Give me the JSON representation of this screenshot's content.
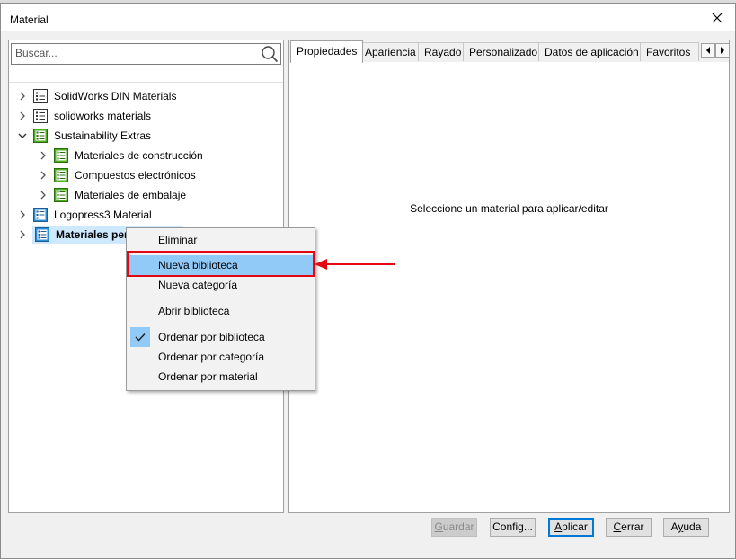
{
  "window": {
    "title": "Material"
  },
  "search": {
    "placeholder": "Buscar..."
  },
  "tree": {
    "items": [
      {
        "label": "SolidWorks DIN Materials"
      },
      {
        "label": "solidworks materials"
      },
      {
        "label": "Sustainability Extras"
      },
      {
        "label": "Materiales de construcción"
      },
      {
        "label": "Compuestos electrónicos"
      },
      {
        "label": "Materiales de embalaje"
      },
      {
        "label": "Logopress3 Material"
      },
      {
        "label": "Materiales pers"
      }
    ]
  },
  "tabs": [
    "Propiedades",
    "Apariencia",
    "Rayado",
    "Personalizado",
    "Datos de aplicación",
    "Favoritos"
  ],
  "main": {
    "message": "Seleccione un material para aplicar/editar"
  },
  "buttons": {
    "guardar": {
      "pre": "",
      "accel": "G",
      "post": "uardar"
    },
    "config": {
      "pre": "Confi",
      "accel": "g",
      "post": "..."
    },
    "aplicar": {
      "pre": "",
      "accel": "A",
      "post": "plicar"
    },
    "cerrar": {
      "pre": "",
      "accel": "C",
      "post": "errar"
    },
    "ayuda": {
      "pre": "A",
      "accel": "y",
      "post": "uda"
    }
  },
  "context_menu": {
    "items": [
      {
        "label": "Eliminar"
      },
      {
        "label": "Nueva biblioteca"
      },
      {
        "label": "Nueva categoría"
      },
      {
        "label": "Abrir biblioteca"
      },
      {
        "label": "Ordenar por biblioteca"
      },
      {
        "label": "Ordenar por categoría"
      },
      {
        "label": "Ordenar por material"
      }
    ]
  },
  "colors": {
    "highlight": "#91c9f7",
    "selection": "#cde8ff",
    "annotation_red": "#e30613",
    "library_icon_green": "#4caf1f",
    "library_icon_blue": "#2d8ed8"
  }
}
